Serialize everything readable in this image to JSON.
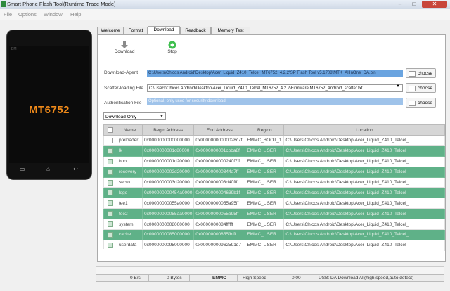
{
  "window": {
    "title": "Smart Phone Flash Tool(Runtime Trace Mode)",
    "minimize": "–",
    "maximize": "□",
    "close": "✕"
  },
  "menu": [
    "File",
    "Options",
    "Window",
    "Help"
  ],
  "phone": {
    "brand": "BM",
    "model": "MT6752"
  },
  "tabs": [
    "Welcome",
    "Format",
    "Download",
    "Readback",
    "Memory Test"
  ],
  "toolbar": {
    "download": "Download",
    "stop": "Stop"
  },
  "download_agent": {
    "label": "Download-Agent",
    "value": "C:\\Users\\Chicos Android\\Desktop\\Acer_Liquid_Z410_Telcel_MT6752_4.2.2\\SP Flash Tool v5.1708\\MTK_AllInOne_DA.bin"
  },
  "scatter": {
    "label": "Scatter-loading File",
    "value": "C:\\Users\\Chicos Android\\Desktop\\Acer_Liquid_Z410_Telcel_MT6752_4.2.2\\Firmware\\MT6752_Android_scatter.txt"
  },
  "auth": {
    "label": "Authentication File",
    "placeholder": "Optional, only used for security download"
  },
  "choose_label": "choose",
  "mode": {
    "value": "Download Only"
  },
  "table": {
    "columns": [
      "Name",
      "Begin Address",
      "End Address",
      "Region",
      "Location"
    ],
    "rows": [
      {
        "checked": false,
        "selected": false,
        "name": "preloader",
        "begin": "0x0000000000000000",
        "end": "0x00000000000028c7f",
        "region": "EMMC_BOOT_1",
        "location": "C:\\Users\\Chicos Android\\Desktop\\Acer_Liquid_Z410_Telcel_"
      },
      {
        "checked": true,
        "selected": true,
        "name": "lk",
        "begin": "0x0000000001c80000",
        "end": "0x0000000001cbba8f",
        "region": "EMMC_USER",
        "location": "C:\\Users\\Chicos Android\\Desktop\\Acer_Liquid_Z410_Telcel_"
      },
      {
        "checked": true,
        "selected": false,
        "name": "boot",
        "begin": "0x0000000001d20000",
        "end": "0x0000000000240f7ff",
        "region": "EMMC_USER",
        "location": "C:\\Users\\Chicos Android\\Desktop\\Acer_Liquid_Z410_Telcel_"
      },
      {
        "checked": true,
        "selected": true,
        "name": "recovery",
        "begin": "0x0000000002d20000",
        "end": "0x000000000344a7ff",
        "region": "EMMC_USER",
        "location": "C:\\Users\\Chicos Android\\Desktop\\Acer_Liquid_Z410_Telcel_"
      },
      {
        "checked": true,
        "selected": false,
        "name": "secro",
        "begin": "0x0000000003d20000",
        "end": "0x0000000003d40fff",
        "region": "EMMC_USER",
        "location": "C:\\Users\\Chicos Android\\Desktop\\Acer_Liquid_Z410_Telcel_"
      },
      {
        "checked": true,
        "selected": true,
        "name": "logo",
        "begin": "0x000000000454a0000",
        "end": "0x0000000004639b1f",
        "region": "EMMC_USER",
        "location": "C:\\Users\\Chicos Android\\Desktop\\Acer_Liquid_Z410_Telcel_"
      },
      {
        "checked": true,
        "selected": false,
        "name": "tee1",
        "begin": "0x00000000055a0000",
        "end": "0x00000000055a95ff",
        "region": "EMMC_USER",
        "location": "C:\\Users\\Chicos Android\\Desktop\\Acer_Liquid_Z410_Telcel_"
      },
      {
        "checked": true,
        "selected": true,
        "name": "tee2",
        "begin": "0x00000000055aa0000",
        "end": "0x00000000055a95ff",
        "region": "EMMC_USER",
        "location": "C:\\Users\\Chicos Android\\Desktop\\Acer_Liquid_Z410_Telcel_"
      },
      {
        "checked": true,
        "selected": false,
        "name": "system",
        "begin": "0x0000000008000000",
        "end": "0x0000000084ffffff",
        "region": "EMMC_USER",
        "location": "C:\\Users\\Chicos Android\\Desktop\\Acer_Liquid_Z410_Telcel_"
      },
      {
        "checked": true,
        "selected": true,
        "name": "cache",
        "begin": "0x0000000085000000",
        "end": "0x00000000855fbfff",
        "region": "EMMC_USER",
        "location": "C:\\Users\\Chicos Android\\Desktop\\Acer_Liquid_Z410_Telcel_"
      },
      {
        "checked": true,
        "selected": false,
        "name": "userdata",
        "begin": "0x0000000095000000",
        "end": "0x00000000962591d7",
        "region": "EMMC_USER",
        "location": "C:\\Users\\Chicos Android\\Desktop\\Acer_Liquid_Z410_Telcel_"
      }
    ]
  },
  "status": {
    "speed": "0 B/s",
    "bytes": "0 Bytes",
    "storage": "EMMC",
    "usb_speed": "High Speed",
    "time": "0:00",
    "message": "USB: DA Download All(high speed,auto detect)"
  },
  "colors": {
    "selected_row": "#5fb188",
    "accent": "#f08a1a"
  }
}
